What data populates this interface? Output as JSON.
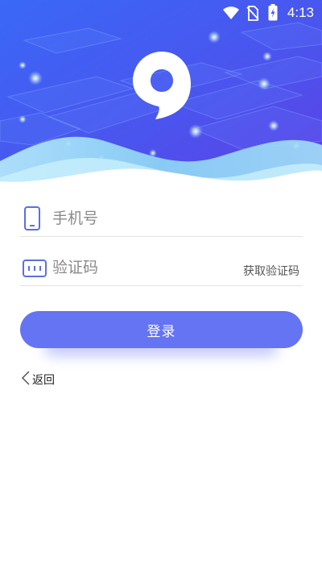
{
  "status_bar": {
    "time": "4:13",
    "icons": [
      "wifi-icon",
      "no-sim-icon",
      "battery-charging-icon"
    ]
  },
  "header": {
    "logo_icon": "app-logo-icon",
    "colors": {
      "gradient_start": "#3d5df5",
      "gradient_end": "#5b43e8",
      "wave_light": "#9fe0f7"
    }
  },
  "form": {
    "phone": {
      "icon": "phone-icon",
      "placeholder": "手机号",
      "value": ""
    },
    "code": {
      "icon": "keypad-icon",
      "placeholder": "验证码",
      "value": "",
      "get_code_label": "获取验证码"
    },
    "login_label": "登录"
  },
  "back": {
    "icon": "chevron-left-icon",
    "label": "返回"
  },
  "colors": {
    "accent": "#6474f2",
    "field_icon": "#5c6fe0"
  }
}
